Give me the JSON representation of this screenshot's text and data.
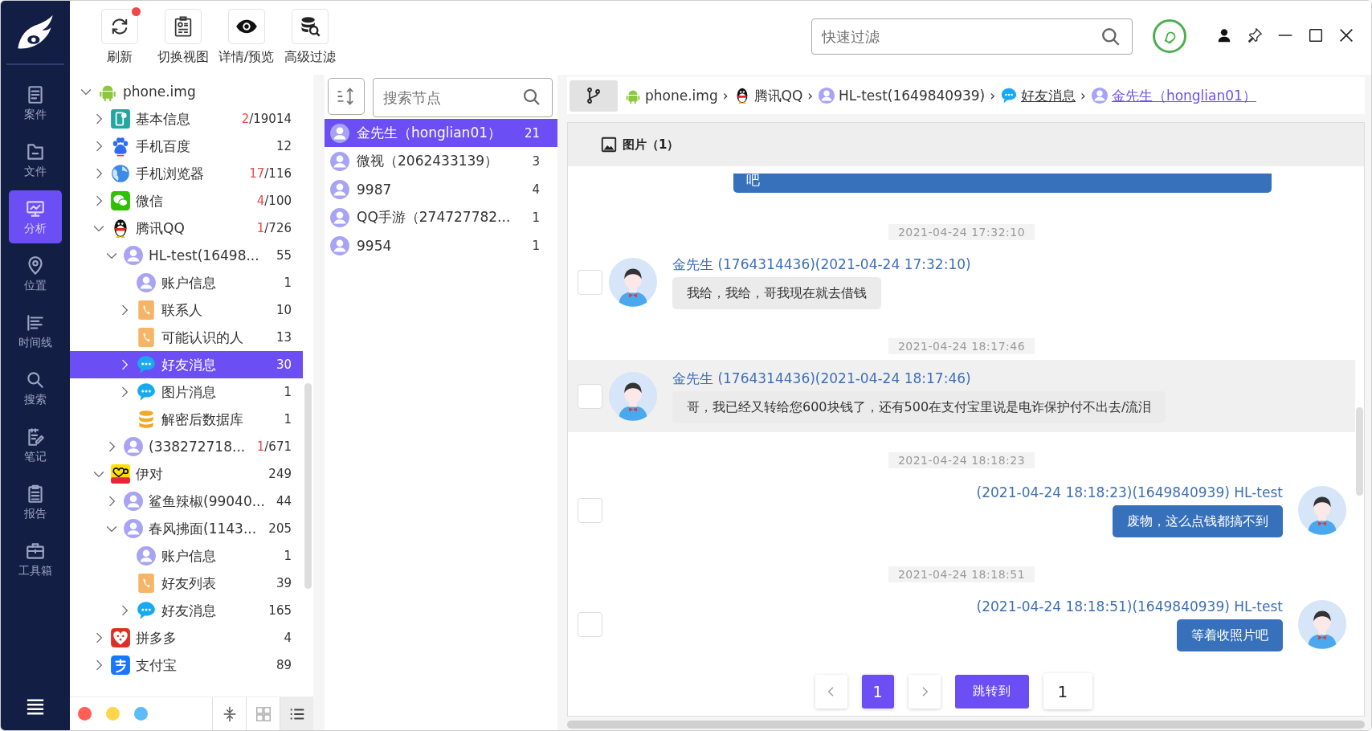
{
  "nav": {
    "items": [
      {
        "label": "案件",
        "kind": "case",
        "selected": false
      },
      {
        "label": "文件",
        "kind": "file",
        "selected": false
      },
      {
        "label": "分析",
        "kind": "analysis",
        "selected": true
      },
      {
        "label": "位置",
        "kind": "location",
        "selected": false
      },
      {
        "label": "时间线",
        "kind": "timeline",
        "selected": false
      },
      {
        "label": "搜索",
        "kind": "search",
        "selected": false
      },
      {
        "label": "笔记",
        "kind": "note",
        "selected": false
      },
      {
        "label": "报告",
        "kind": "report",
        "selected": false
      },
      {
        "label": "工具箱",
        "kind": "toolbox",
        "selected": false
      }
    ]
  },
  "toolbar": {
    "buttons": [
      {
        "label": "刷新",
        "kind": "refresh",
        "badge": true
      },
      {
        "label": "切换视图",
        "kind": "view",
        "badge": false
      },
      {
        "label": "详情/预览",
        "kind": "eye",
        "badge": false
      },
      {
        "label": "高级过滤",
        "kind": "filter",
        "badge": false
      }
    ],
    "filter": {
      "placeholder": "快速过滤"
    }
  },
  "tree": {
    "nodes": [
      {
        "label": "phone.img",
        "kind": "android",
        "expanded": true,
        "selected": false,
        "children": [
          {
            "label": "基本信息",
            "kind": "info",
            "flagged": "2",
            "count": "/19014",
            "expanded": false,
            "selected": false
          },
          {
            "label": "手机百度",
            "kind": "baidu",
            "count": "12",
            "expanded": false,
            "selected": false
          },
          {
            "label": "手机浏览器",
            "kind": "browser",
            "flagged": "17",
            "count": "/116",
            "expanded": false,
            "selected": false
          },
          {
            "label": "微信",
            "kind": "wechat",
            "flagged": "4",
            "count": "/100",
            "expanded": false,
            "selected": false
          },
          {
            "label": "腾讯QQ",
            "kind": "qq",
            "flagged": "1",
            "count": "/726",
            "expanded": true,
            "selected": false,
            "children": [
              {
                "label": "HL-test(16498...",
                "kind": "person",
                "count": "55",
                "expanded": true,
                "selected": false,
                "children": [
                  {
                    "label": "账户信息",
                    "kind": "person",
                    "count": "1",
                    "selected": false
                  },
                  {
                    "label": "联系人",
                    "kind": "contact",
                    "count": "10",
                    "expanded": false,
                    "selected": false
                  },
                  {
                    "label": "可能认识的人",
                    "kind": "contact",
                    "count": "13",
                    "selected": false
                  },
                  {
                    "label": "好友消息",
                    "kind": "chat",
                    "count": "30",
                    "expanded": false,
                    "selected": true
                  },
                  {
                    "label": "图片消息",
                    "kind": "chat",
                    "count": "1",
                    "expanded": false,
                    "selected": false
                  },
                  {
                    "label": "解密后数据库",
                    "kind": "database",
                    "count": "1",
                    "selected": false
                  }
                ]
              },
              {
                "label": "(338272718...",
                "kind": "person",
                "flagged": "1",
                "count": "/671",
                "expanded": false,
                "selected": false
              }
            ]
          },
          {
            "label": "伊对",
            "kind": "yidui",
            "count": "249",
            "expanded": true,
            "selected": false,
            "children": [
              {
                "label": "鲨鱼辣椒(99040...",
                "kind": "person",
                "count": "44",
                "expanded": false,
                "selected": false
              },
              {
                "label": "春风拂面(1143...",
                "kind": "person",
                "count": "205",
                "expanded": true,
                "selected": false,
                "children": [
                  {
                    "label": "账户信息",
                    "kind": "person",
                    "count": "1",
                    "selected": false
                  },
                  {
                    "label": "好友列表",
                    "kind": "contact",
                    "count": "39",
                    "selected": false
                  },
                  {
                    "label": "好友消息",
                    "kind": "chat",
                    "count": "165",
                    "expanded": false,
                    "selected": false
                  }
                ]
              }
            ]
          },
          {
            "label": "拼多多",
            "kind": "pinduoduo",
            "count": "4",
            "expanded": false,
            "selected": false
          },
          {
            "label": "支付宝",
            "kind": "alipay",
            "count": "89",
            "expanded": false,
            "selected": false
          }
        ]
      }
    ]
  },
  "tree_footer": {
    "tags": [
      {
        "color": "#ff5f57"
      },
      {
        "color": "#ffd54a"
      },
      {
        "color": "#5bbcf7"
      }
    ],
    "views": [
      {
        "kind": "collapse",
        "selected": false
      },
      {
        "kind": "grid",
        "selected": false
      },
      {
        "kind": "list",
        "selected": true
      }
    ]
  },
  "contacts": {
    "search": {
      "placeholder": "搜索节点"
    },
    "items": [
      {
        "name": "金先生（honglian01）",
        "count": "21",
        "selected": true
      },
      {
        "name": "微视（2062433139）",
        "count": "3",
        "selected": false
      },
      {
        "name": "9987",
        "count": "4",
        "selected": false
      },
      {
        "name": "QQ手游（274727782...",
        "count": "1",
        "selected": false
      },
      {
        "name": "9954",
        "count": "1",
        "selected": false
      }
    ]
  },
  "chat": {
    "breadcrumb": [
      {
        "text": "phone.img",
        "kind": "android",
        "link": false,
        "selected": false
      },
      {
        "sep": "›",
        "text": "腾讯QQ",
        "kind": "qq",
        "link": false,
        "selected": false
      },
      {
        "sep": "›",
        "text": "HL-test(1649840939)",
        "kind": "person",
        "link": false,
        "selected": false
      },
      {
        "sep": "›",
        "text": "好友消息",
        "kind": "chat",
        "link": true,
        "selected": false
      },
      {
        "sep": "›",
        "text": "金先生（honglian01）",
        "kind": "person",
        "link": true,
        "selected": true
      }
    ],
    "media_tab": {
      "label": "图片（1）"
    },
    "cut_message": {
      "text": "吧"
    },
    "messages": [
      {
        "time": "2021-04-24 17:32:10",
        "sender": "金先生 (1764314436)(2021-04-24 17:32:10)",
        "text": "我给，我给，哥我现在就去借钱",
        "kind": "incoming",
        "highlighted": false,
        "checked": false
      },
      {
        "time": "2021-04-24 18:17:46",
        "sender": "金先生 (1764314436)(2021-04-24 18:17:46)",
        "text": "哥，我已经又转给您600块钱了，还有500在支付宝里说是电诈保护付不出去/流泪",
        "kind": "incoming",
        "highlighted": true,
        "checked": false
      },
      {
        "time": "2021-04-24 18:18:23",
        "sender": "(2021-04-24 18:18:23)(1649840939) HL-test",
        "text": "废物，这么点钱都搞不到",
        "kind": "outgoing",
        "highlighted": false,
        "checked": false
      },
      {
        "time": "2021-04-24 18:18:51",
        "sender": "(2021-04-24 18:18:51)(1649840939) HL-test",
        "text": "等着收照片吧",
        "kind": "outgoing",
        "highlighted": false,
        "checked": false
      }
    ],
    "pagination": {
      "pages": [
        {
          "label": "1",
          "selected": true
        }
      ],
      "jump_label": "跳转到",
      "jump_value": "1"
    }
  }
}
